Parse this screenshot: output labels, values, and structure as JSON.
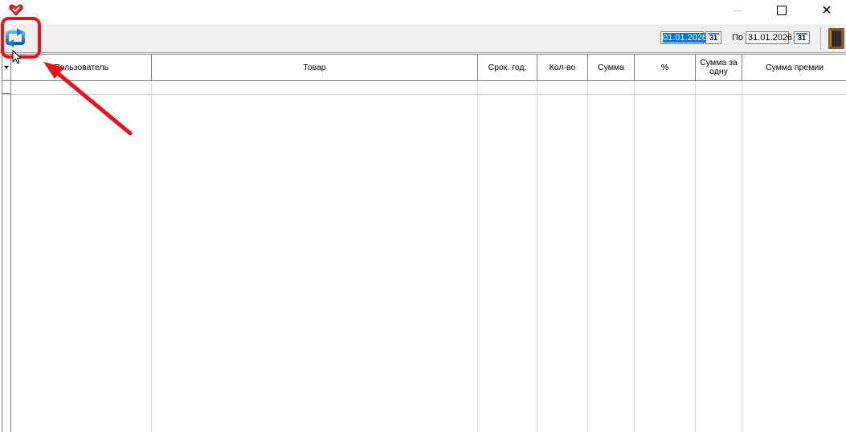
{
  "window": {
    "minimize_label": "",
    "maximize_label": "",
    "close_label": "✕"
  },
  "toolbar": {
    "date_from": "01.01.2026",
    "date_to_label": "По",
    "date_to": "31.01.2026",
    "calendar_label": "31"
  },
  "grid": {
    "columns": [
      {
        "label": "Пользователь"
      },
      {
        "label": "Товар"
      },
      {
        "label": "Срок. год."
      },
      {
        "label": "Кол-во"
      },
      {
        "label": "Сумма"
      },
      {
        "label": "%"
      },
      {
        "label": "Сумма за одну"
      },
      {
        "label": "Сумма премии"
      }
    ],
    "rows": []
  },
  "colors": {
    "annotation": "#e8121d",
    "selection": "#0078d7",
    "toolbar_bg": "#f0f0f0"
  },
  "icons": {
    "app": "heart-app-icon",
    "refresh": "refresh-icon",
    "exit": "exit-door-icon",
    "calendar": "calendar-icon"
  }
}
